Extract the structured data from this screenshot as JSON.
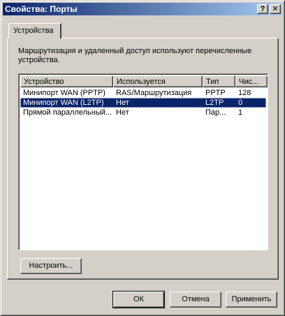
{
  "window": {
    "title": "Свойства: Порты",
    "help_glyph": "?",
    "close_glyph": "✕"
  },
  "tabs": [
    {
      "label": "Устройства",
      "active": true
    }
  ],
  "description": "Маршрутизация и удаленный доступ используют перечисленные устройства.",
  "list": {
    "columns": [
      "Устройство",
      "Используется",
      "Тип",
      "Чис..."
    ],
    "rows": [
      {
        "device": "Минипорт WAN (PPTP)",
        "used_by": "RAS/Маршрутизация",
        "type": "PPTP",
        "count": "128",
        "selected": false
      },
      {
        "device": "Минипорт WAN (L2TP)",
        "used_by": "Нет",
        "type": "L2TP",
        "count": "0",
        "selected": true
      },
      {
        "device": "Прямой параллельный...",
        "used_by": "Нет",
        "type": "Пар...",
        "count": "1",
        "selected": false
      }
    ]
  },
  "buttons": {
    "configure": "Настроить...",
    "ok": "ОК",
    "cancel": "Отмена",
    "apply": "Применить"
  },
  "colors": {
    "title_gradient_start": "#0a246a",
    "title_gradient_end": "#a6caf0",
    "selection": "#0a246a",
    "face": "#d4d0c8"
  }
}
